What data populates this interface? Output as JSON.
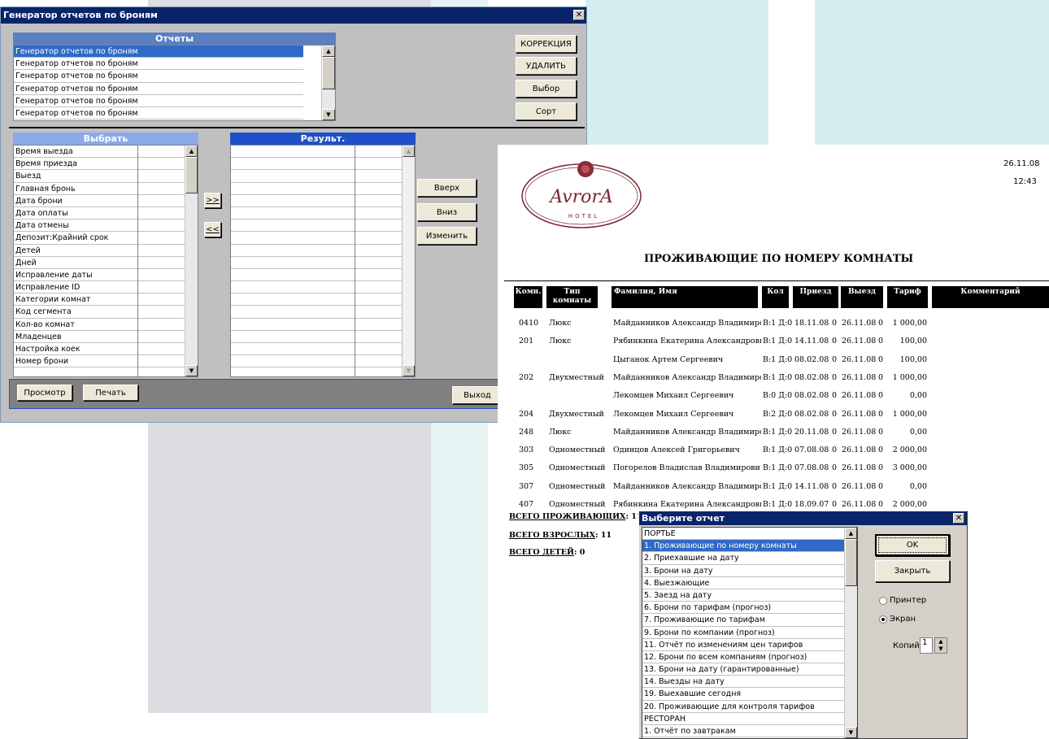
{
  "gen_window": {
    "title": "Генератор отчетов по броням",
    "reports_header": "Отчеты",
    "reports": [
      "Генератор отчетов по броням",
      "Генератор отчетов по броням",
      "Генератор отчетов по броням",
      "Генератор отчетов по броням",
      "Генератор отчетов по броням",
      "Генератор отчетов по броням"
    ],
    "buttons_right": [
      "КОРРЕКЦИЯ",
      "УДАЛИТЬ",
      "Выбор",
      "Сорт"
    ],
    "choose_header": "Выбрать",
    "choose_items": [
      "Время выезда",
      "Время приезда",
      "Выезд",
      "Главная бронь",
      "Дата брони",
      "Дата оплаты",
      "Дата отмены",
      "Депозит:Крайний срок",
      "Детей",
      "Дней",
      "Исправление даты",
      "Исправление ID",
      "Категории комнат",
      "Код сегмента",
      "Кол-во комнат",
      "Младенцев",
      "Настройка коек",
      "Номер брони"
    ],
    "add_label": ">>",
    "remove_label": "<<",
    "result_header": "Результ.",
    "move_buttons": [
      "Вверх",
      "Вниз",
      "Изменить"
    ],
    "preview_label": "Просмотр",
    "print_label": "Печать",
    "exit_label": "Выход"
  },
  "report": {
    "logo_text": "AvrorA",
    "logo_sub": "HOTEL",
    "date": "26.11.08",
    "time": "12:43",
    "title": "ПРОЖИВАЮЩИЕ ПО НОМЕРУ КОМНАТЫ",
    "columns": [
      "Комн.",
      "Тип комнаты",
      "Фамилия, Имя",
      "Кол",
      "Приезд",
      "Выезд",
      "Тариф",
      "Комментарий"
    ],
    "rows": [
      {
        "room": "0410",
        "type": "Люкс",
        "name": "Майданников Александр Владимиро",
        "count": "В:1 Д:0",
        "arrive": "18.11.08",
        "n": "0",
        "depart": "26.11.08",
        "n2": "0",
        "rate": "1 000,00"
      },
      {
        "room": "201",
        "type": "Люкс",
        "name": "Рябинкина Екатерина Александровн",
        "count": "В:1 Д:0",
        "arrive": "14.11.08",
        "n": "0",
        "depart": "26.11.08",
        "n2": "0",
        "rate": "100,00"
      },
      {
        "room": "",
        "type": "",
        "name": "Цыганок Артем Сергеевич",
        "count": "В:1 Д:0",
        "arrive": "08.02.08",
        "n": "0",
        "depart": "26.11.08",
        "n2": "0",
        "rate": "100,00"
      },
      {
        "room": "202",
        "type": "Двухместный",
        "name": "Майданников Александр Владимиро",
        "count": "В:1 Д:0",
        "arrive": "08.02.08",
        "n": "0",
        "depart": "26.11.08",
        "n2": "0",
        "rate": "1 000,00"
      },
      {
        "room": "",
        "type": "",
        "name": "Лекомцев Михаил Сергеевич",
        "count": "В:0 Д:0",
        "arrive": "08.02.08",
        "n": "0",
        "depart": "26.11.08",
        "n2": "0",
        "rate": "0,00"
      },
      {
        "room": "204",
        "type": "Двухместный",
        "name": "Лекомцев Михаил Сергеевич",
        "count": "В:2 Д:0",
        "arrive": "08.02.08",
        "n": "0",
        "depart": "26.11.08",
        "n2": "0",
        "rate": "1 000,00"
      },
      {
        "room": "248",
        "type": "Люкс",
        "name": "Майданников Александр Владимиро",
        "count": "В:1 Д:0",
        "arrive": "20.11.08",
        "n": "0",
        "depart": "26.11.08",
        "n2": "0",
        "rate": "0,00"
      },
      {
        "room": "303",
        "type": "Одноместный",
        "name": "Одинцов Алексей Григорьевич",
        "count": "В:1 Д:0",
        "arrive": "07.08.08",
        "n": "0",
        "depart": "26.11.08",
        "n2": "0",
        "rate": "2 000,00"
      },
      {
        "room": "305",
        "type": "Одноместный",
        "name": "Погорелов Владислав Владимирови",
        "count": "В:1 Д:0",
        "arrive": "07.08.08",
        "n": "0",
        "depart": "26.11.08",
        "n2": "0",
        "rate": "3 000,00"
      },
      {
        "room": "307",
        "type": "Одноместный",
        "name": "Майданников Александр Владимиро",
        "count": "В:1 Д:0",
        "arrive": "14.11.08",
        "n": "0",
        "depart": "26.11.08",
        "n2": "0",
        "rate": "0,00"
      },
      {
        "room": "407",
        "type": "Одноместный",
        "name": "Рябинкина Екатерина Александровн",
        "count": "В:1 Д:0",
        "arrive": "18.09.07",
        "n": "0",
        "depart": "26.11.08",
        "n2": "0",
        "rate": "2 000,00"
      }
    ],
    "total_residents_label": "ВСЕГО ПРОЖИВАЮЩИХ",
    "total_residents": ": 11",
    "total_adults_label": "ВСЕГО ВЗРОСЛЫХ",
    "total_adults": ": 11",
    "total_children_label": "ВСЕГО ДЕТЕЙ",
    "total_children": ": 0"
  },
  "dialog": {
    "title": "Выберите отчет",
    "items": [
      "ПОРТЬЕ",
      "1.  Проживающие по номеру комнаты",
      "2.  Приехавшие на дату",
      "3.  Брони на дату",
      "4. Выезжающие",
      "5. Заезд на дату",
      "6. Брони по тарифам (прогноз)",
      "7. Проживающие по тарифам",
      "9. Брони по компании (прогноз)",
      "11.  Отчёт по изменениям цен тарифов",
      "12. Брони по всем компаниям (прогноз)",
      "13. Брони на дату (гарантированные)",
      "14. Выезды на дату",
      "19. Выехавшие сегодня",
      "20. Проживающие для контроля тарифов",
      "РЕСТОРАН",
      "1.  Отчёт по завтракам"
    ],
    "selected_index": 1,
    "ok_label": "OK",
    "close_label": "Закрыть",
    "printer_label": "Принтер",
    "screen_label": "Экран",
    "output_selected": "Экран",
    "copies_label": "Копий:",
    "copies_value": "1"
  }
}
